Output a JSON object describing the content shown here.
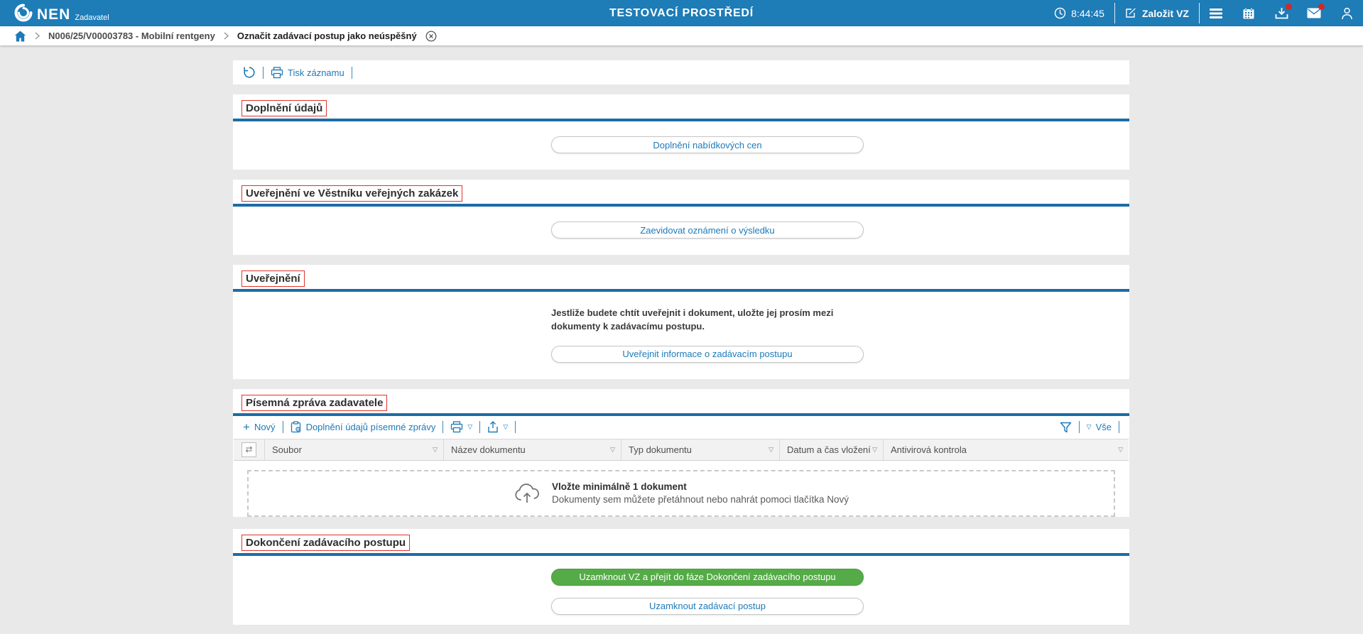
{
  "header": {
    "logo_text": "NEN",
    "logo_subtext": "Zadavatel",
    "env_title": "TESTOVACÍ PROSTŘEDÍ",
    "time": "8:44:45",
    "create_vz_label": "Založit VZ",
    "icons": [
      "clock-icon",
      "compose-icon",
      "hamburger-menu-icon",
      "calendar-icon",
      "downloads-tray-icon",
      "mail-icon",
      "user-icon"
    ],
    "notification_badges": {
      "downloads": true,
      "mail": true
    }
  },
  "breadcrumb": {
    "items": [
      "N006/25/V00003783 - Mobilní rentgeny",
      "Označit zadávací postup jako neúspěšný"
    ]
  },
  "record_toolbar": {
    "print_label": "Tisk záznamu"
  },
  "sections": {
    "doplneni_udaju": {
      "title": "Doplnění údajů",
      "button": "Doplnění nabídkových cen"
    },
    "vestnik": {
      "title": "Uveřejnění ve Věstníku veřejných zakázek",
      "button": "Zaevidovat oznámení o výsledku"
    },
    "uverejneni": {
      "title": "Uveřejnění",
      "note": "Jestliže budete chtít uveřejnit i dokument, uložte jej prosím mezi dokumenty k zadávacímu postupu.",
      "button": "Uveřejnit informace o zadávacím postupu"
    },
    "pisemna_zprava": {
      "title": "Písemná zpráva zadavatele",
      "toolbar": {
        "new_label": "Nový",
        "fill_label": "Doplnění údajů písemné zprávy",
        "filter_all_label": "Vše"
      },
      "table": {
        "columns": [
          "Soubor",
          "Název dokumentu",
          "Typ dokumentu",
          "Datum a čas vložení",
          "Antivirová kontrola"
        ],
        "rows": []
      },
      "dropzone": {
        "title": "Vložte minimálně 1 dokument",
        "subtitle": "Dokumenty sem můžete přetáhnout nebo nahrát pomoci tlačítka Nový"
      }
    },
    "dokonceni": {
      "title": "Dokončení zadávacího postupu",
      "primary_button": "Uzamknout VZ a přejít do fáze Dokončení zadávacího postupu",
      "secondary_button": "Uzamknout zadávací postup"
    }
  },
  "colors": {
    "header_blue": "#1e7cb7",
    "link_blue": "#1d7ab8",
    "section_line_blue": "#1c6ca6",
    "highlight_red": "#e0332c",
    "success_green": "#55ab47",
    "badge_red": "#cf2a27"
  }
}
